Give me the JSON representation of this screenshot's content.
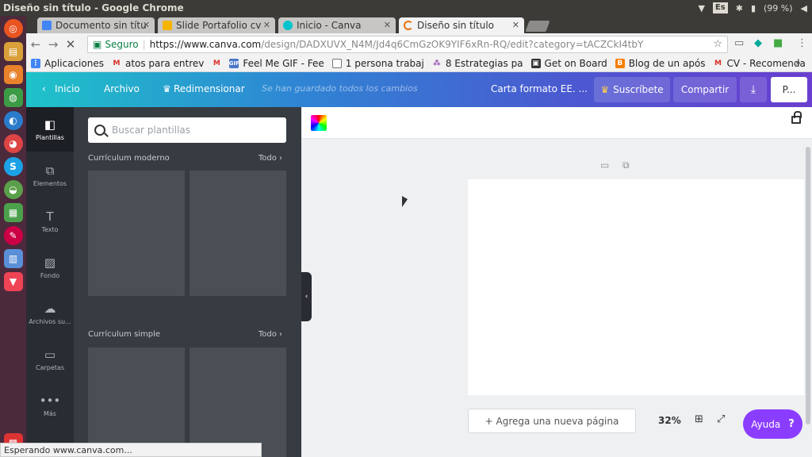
{
  "os": {
    "window_title": "Diseño sin título - Google Chrome",
    "lang": "Es",
    "battery": "(99 %)"
  },
  "tabs": [
    {
      "title": "Documento sin títu",
      "favicon_color": "#4285f4"
    },
    {
      "title": "Slide Portafolio cv",
      "favicon_color": "#f4b400"
    },
    {
      "title": "Inicio - Canva",
      "favicon_color": "#00c4cc"
    },
    {
      "title": "Diseño sin título",
      "favicon_color": "#e8710a"
    }
  ],
  "address": {
    "secure_label": "Seguro",
    "url_host": "https://www.canva.com",
    "url_path": "/design/DADXUVX_N4M/Jd4q6CmGzOK9YIF6xRn-RQ/edit?category=tACZCkI4tbY"
  },
  "bookmarks": [
    {
      "label": "Aplicaciones",
      "icon": "apps-grid-icon"
    },
    {
      "label": "atos para entrev",
      "icon": "gmail-icon"
    },
    {
      "label": "",
      "icon": "gmail-icon"
    },
    {
      "label": "Feel Me GIF - Fee",
      "icon": "gif-icon"
    },
    {
      "label": "1 persona trabaj",
      "icon": "page-icon"
    },
    {
      "label": "8 Estrategias pa",
      "icon": "podcast-icon"
    },
    {
      "label": "Get on Board",
      "icon": "getonboard-icon"
    },
    {
      "label": "Blog de un após",
      "icon": "blogger-icon"
    },
    {
      "label": "CV - Recomenda",
      "icon": "gmail-icon"
    }
  ],
  "canva": {
    "topbar": {
      "back_label": "Inicio",
      "file_label": "Archivo",
      "resize_label": "Redimensionar",
      "saved_status": "Se han guardado todos los cambios",
      "design_name": "Carta formato EE. ...",
      "subscribe_label": "Suscríbete",
      "share_label": "Compartir",
      "publish_label": "P..."
    },
    "sidebar": [
      {
        "label": "Plantillas",
        "icon": "templates-icon",
        "active": true
      },
      {
        "label": "Elementos",
        "icon": "elements-icon",
        "active": false
      },
      {
        "label": "Texto",
        "icon": "text-icon",
        "active": false
      },
      {
        "label": "Fondo",
        "icon": "background-icon",
        "active": false
      },
      {
        "label": "Archivos su...",
        "icon": "upload-icon",
        "active": false
      },
      {
        "label": "Carpetas",
        "icon": "folder-icon",
        "active": false
      },
      {
        "label": "Más",
        "icon": "more-icon",
        "active": false
      }
    ],
    "panel": {
      "search_placeholder": "Buscar plantillas",
      "sections": [
        {
          "title": "Currículum moderno",
          "see_all": "Todo"
        },
        {
          "title": "Currículum simple",
          "see_all": "Todo"
        }
      ]
    },
    "editor": {
      "add_page_label": "+ Agrega una nueva página",
      "zoom": "32%",
      "help_label": "Ayuda",
      "help_icon": "?"
    }
  },
  "status_bar": "Esperando www.canva.com..."
}
